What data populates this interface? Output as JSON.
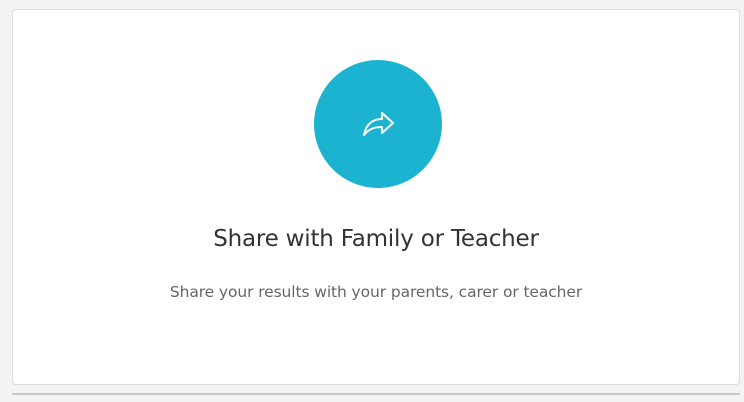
{
  "card": {
    "title": "Share with Family or Teacher",
    "subtitle": "Share your results with your parents, carer or teacher",
    "icon": "share-forward-icon"
  },
  "colors": {
    "accent": "#1bb3cf",
    "icon_stroke": "#ffffff",
    "title_text": "#333333",
    "subtitle_text": "#666666",
    "card_background": "#ffffff",
    "page_background": "#f3f3f3"
  }
}
